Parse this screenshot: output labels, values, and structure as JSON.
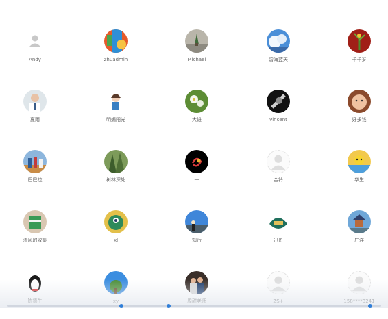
{
  "contacts": [
    {
      "name": "Andy",
      "avatar": "default"
    },
    {
      "name": "zhuadmin",
      "avatar": "photo-colorful"
    },
    {
      "name": "Michael",
      "avatar": "photo-building"
    },
    {
      "name": "碧海蓝天",
      "avatar": "photo-sky"
    },
    {
      "name": "千千岁",
      "avatar": "photo-plant-red"
    },
    {
      "name": "夏雨",
      "avatar": "photo-doctor"
    },
    {
      "name": "明媚阳光",
      "avatar": "photo-cartoon-girl"
    },
    {
      "name": "大雄",
      "avatar": "photo-flower-green"
    },
    {
      "name": "vincent",
      "avatar": "photo-dark-object"
    },
    {
      "name": "好多钱",
      "avatar": "photo-baby"
    },
    {
      "name": "巴巴拉",
      "avatar": "photo-kids-group"
    },
    {
      "name": "树林深处",
      "avatar": "photo-forest"
    },
    {
      "name": "一",
      "avatar": "photo-black-logo"
    },
    {
      "name": "金铃",
      "avatar": "default-dashed"
    },
    {
      "name": "华生",
      "avatar": "photo-pikachu"
    },
    {
      "name": "清风的收集",
      "avatar": "photo-cup"
    },
    {
      "name": "xl",
      "avatar": "photo-green-monster"
    },
    {
      "name": "知行",
      "avatar": "photo-city-sky"
    },
    {
      "name": "迅舟",
      "avatar": "photo-game-logo"
    },
    {
      "name": "广洋",
      "avatar": "photo-temple"
    },
    {
      "name": "陈德生",
      "avatar": "photo-penguin"
    },
    {
      "name": "xy",
      "avatar": "photo-blue-sky-tree"
    },
    {
      "name": "周甜老师",
      "avatar": "photo-people-dark"
    },
    {
      "name": "ZS+",
      "avatar": "default-dashed"
    },
    {
      "name": "158****3241",
      "avatar": "default-dashed"
    }
  ],
  "colors": {
    "accent": "#2f7ed8",
    "name_text": "#666666"
  }
}
